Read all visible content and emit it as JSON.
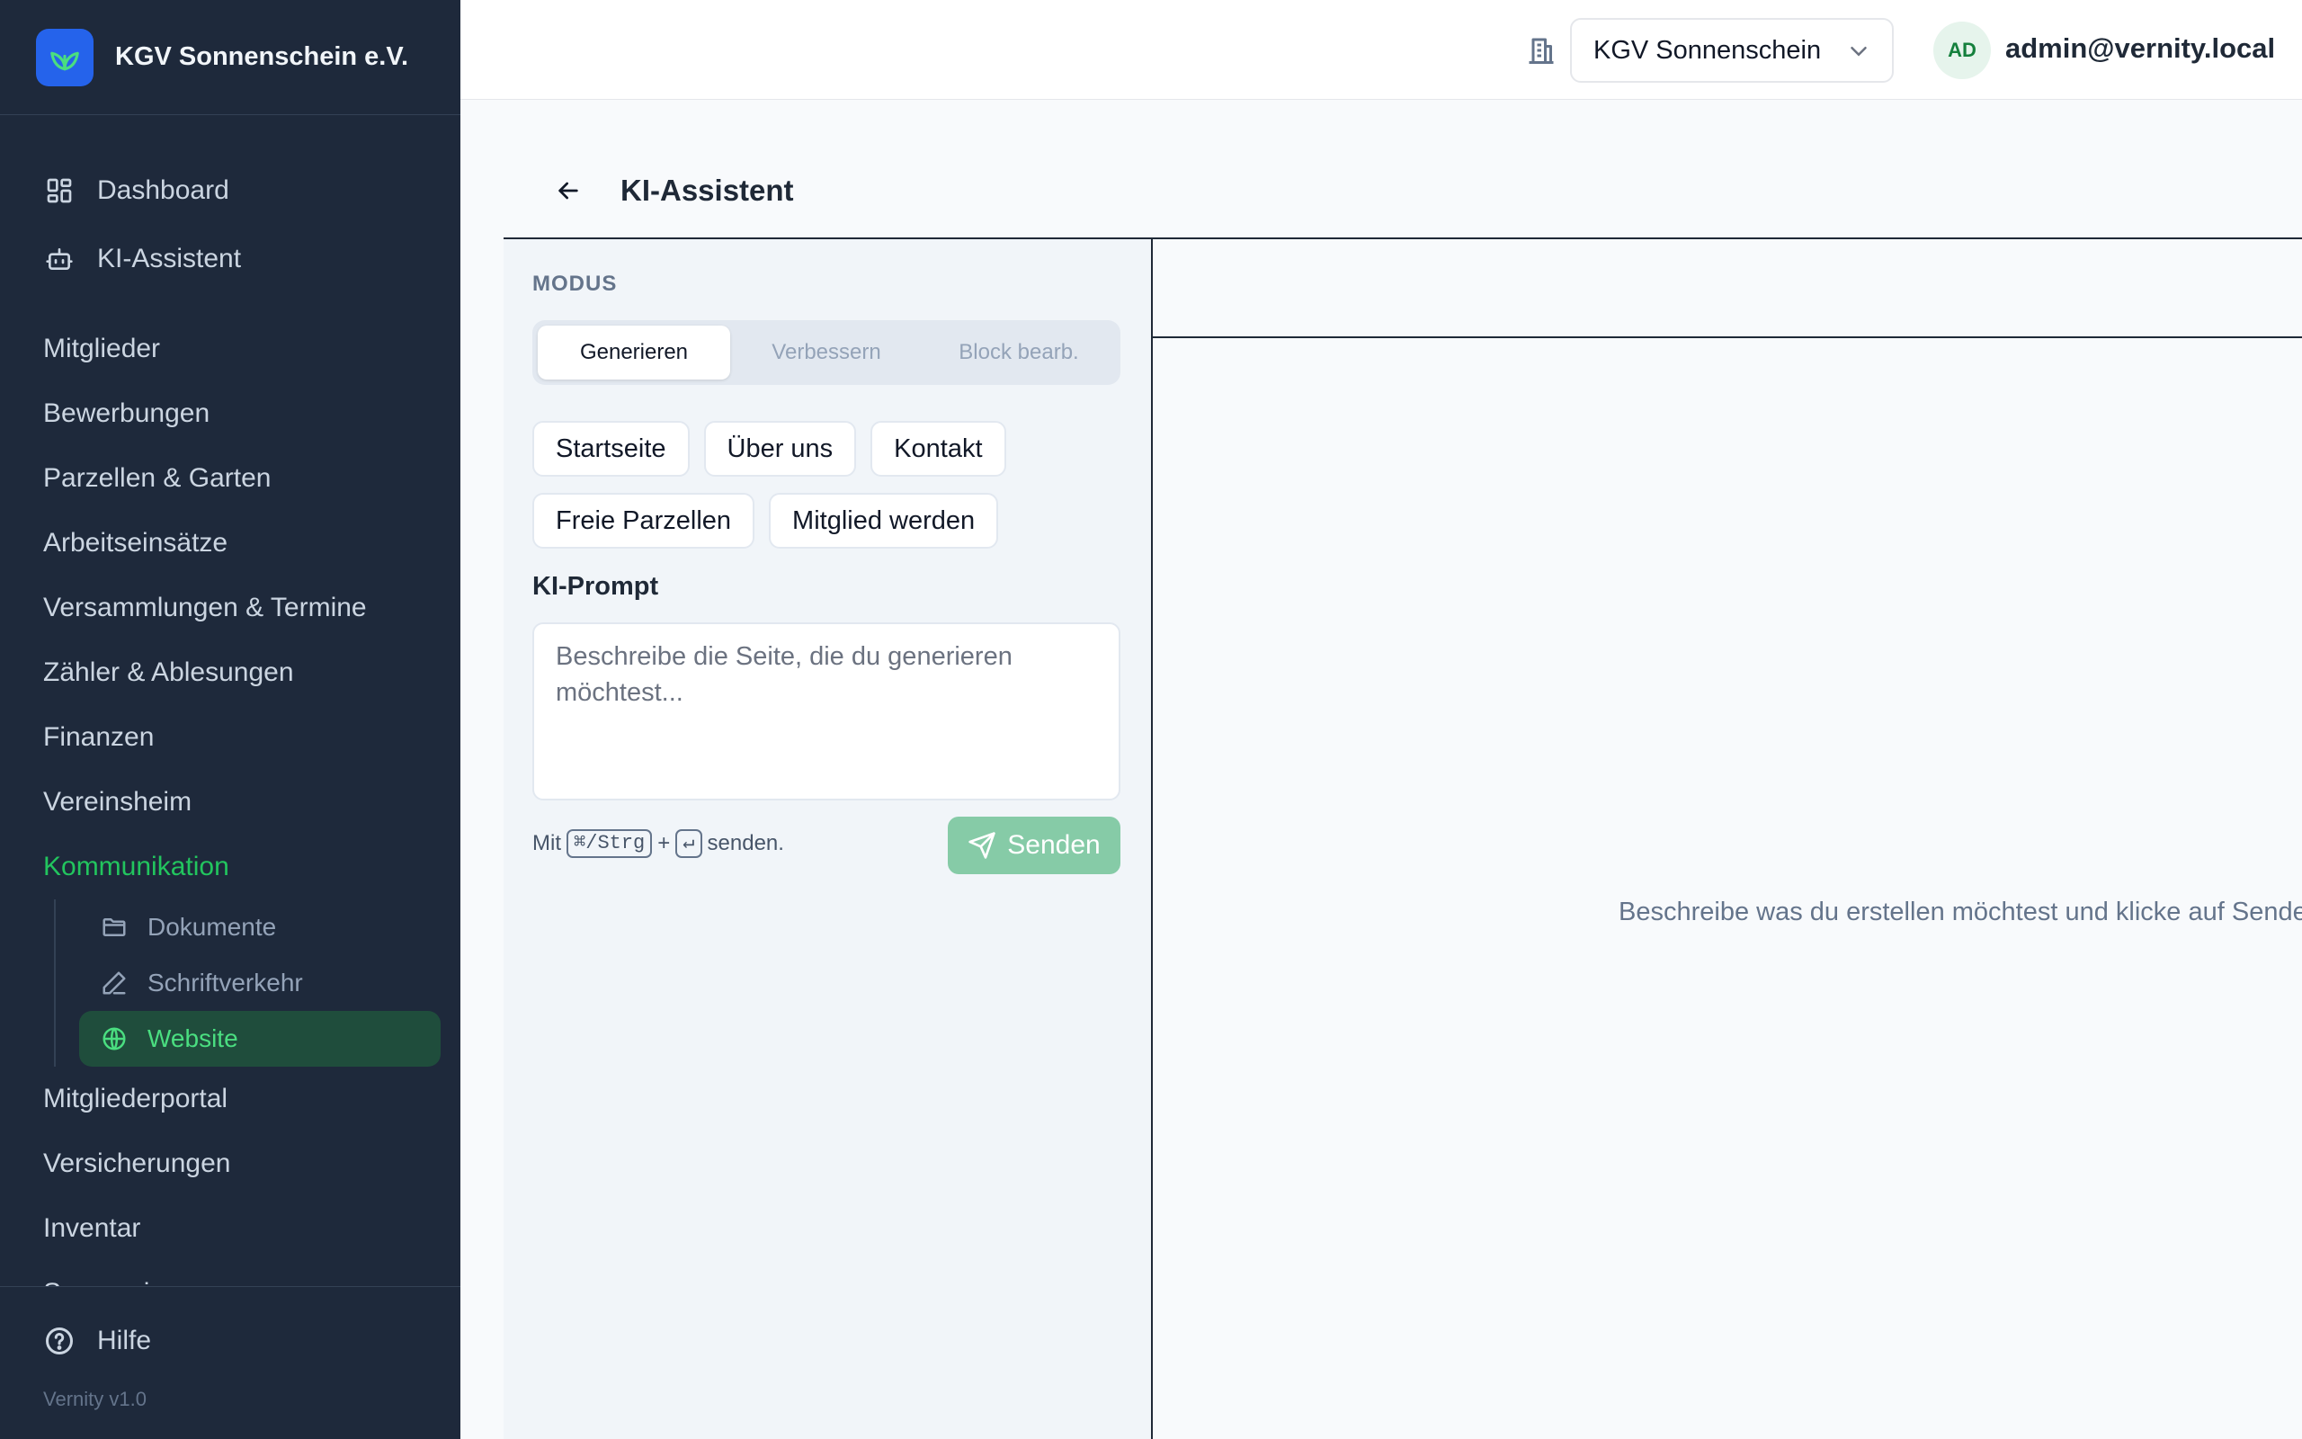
{
  "sidebar": {
    "brand": "KGV Sonnenschein e.V.",
    "top_items": [
      {
        "label": "Dashboard",
        "icon": "dashboard-icon"
      },
      {
        "label": "KI-Assistent",
        "icon": "bot-icon"
      }
    ],
    "items": [
      "Mitglieder",
      "Bewerbungen",
      "Parzellen & Garten",
      "Arbeitseinsätze",
      "Versammlungen & Termine",
      "Zähler & Ablesungen",
      "Finanzen",
      "Vereinsheim",
      "Kommunikation"
    ],
    "sub_items": [
      {
        "label": "Dokumente",
        "icon": "folder-icon"
      },
      {
        "label": "Schriftverkehr",
        "icon": "pen-icon"
      },
      {
        "label": "Website",
        "icon": "globe-icon"
      }
    ],
    "items_after": [
      "Mitgliederportal",
      "Versicherungen",
      "Inventar",
      "Sponsoring"
    ],
    "help": "Hilfe",
    "version": "Vernity v1.0",
    "accent": "#22c55e"
  },
  "topbar": {
    "org_select": "KGV Sonnenschein e.V.",
    "avatar_initials": "AD",
    "user_email": "admin@vernity.local"
  },
  "page": {
    "title": "KI-Assistent"
  },
  "left_panel": {
    "modus_label": "MODUS",
    "modes": [
      "Generieren",
      "Verbessern",
      "Block bearb."
    ],
    "chips_row1": [
      "Startseite",
      "Über uns",
      "Kontakt"
    ],
    "chips_row2": [
      "Freie Parzellen",
      "Mitglied werden"
    ],
    "prompt_label": "KI-Prompt",
    "prompt_placeholder": "Beschreibe die Seite, die du generieren möchtest...",
    "hint_prefix": "Mit",
    "hint_key1": "⌘/Strg",
    "hint_plus": "+",
    "hint_key2": "↵",
    "hint_suffix": "senden.",
    "send_label": "Senden"
  },
  "right_panel": {
    "empty_message": "Beschreibe was du erstellen möchtest und klicke auf Senden."
  }
}
